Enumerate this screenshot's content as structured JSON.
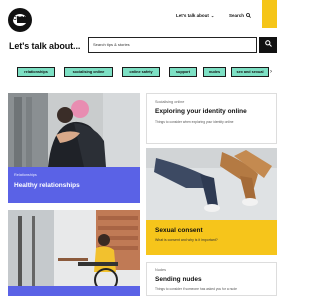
{
  "brand": {
    "logo_text": "CEOP",
    "accent_yellow": "#f5c518"
  },
  "nav": {
    "lets_talk_label": "Let's talk about",
    "search_label": "Search"
  },
  "hero": {
    "headline": "Let's talk about...",
    "search_placeholder": "Search tips & stories"
  },
  "chips": [
    "relationships",
    "socialising online",
    "online safety",
    "support",
    "nudes",
    "sex and sexual"
  ],
  "cards": {
    "healthy": {
      "kicker": "Relationships",
      "title": "Healthy relationships"
    },
    "identity": {
      "kicker": "Socialising online",
      "title": "Exploring your identity online",
      "desc": "Things to consider when exploring your identity online"
    },
    "consent": {
      "title": "Sexual consent",
      "desc": "What is consent and why is it important?"
    },
    "nudes": {
      "kicker": "Nudes",
      "title": "Sending nudes",
      "desc": "Things to consider if someone has asked you for a nude"
    }
  },
  "colors": {
    "chip_bg": "#7de0c4",
    "card_purple": "#5a62e6",
    "card_yellow": "#f6c51b"
  }
}
